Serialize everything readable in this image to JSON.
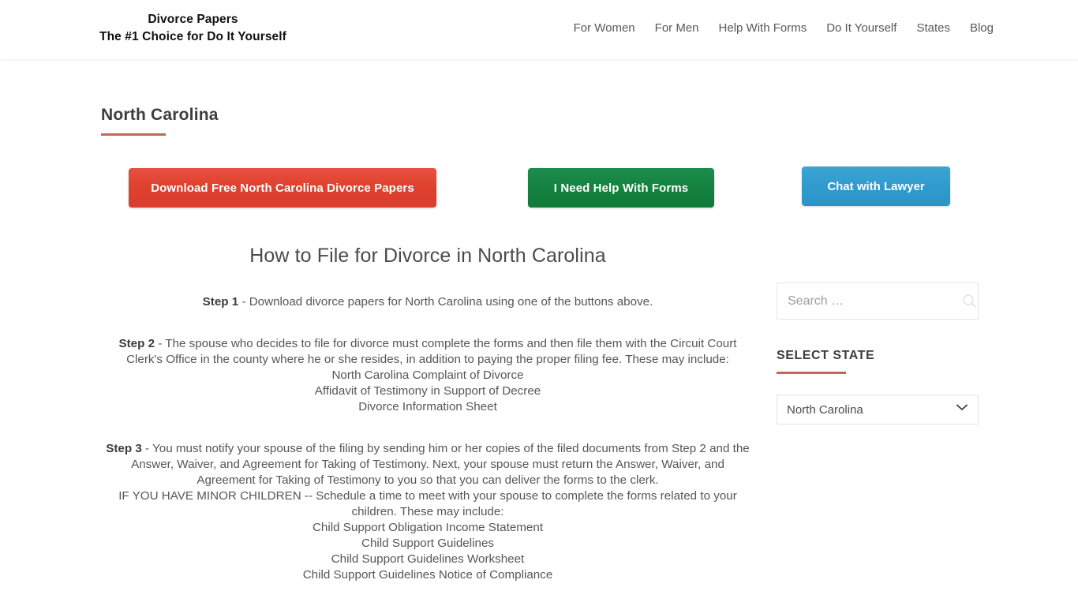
{
  "header": {
    "brand_line1": "Divorce Papers",
    "brand_line2": "The #1 Choice for Do It Yourself",
    "nav": [
      {
        "label": "For Women"
      },
      {
        "label": "For Men"
      },
      {
        "label": "Help With Forms"
      },
      {
        "label": "Do It Yourself"
      },
      {
        "label": "States"
      },
      {
        "label": "Blog"
      }
    ]
  },
  "main": {
    "page_title": "North Carolina",
    "buttons": {
      "download_label": "Download Free North Carolina Divorce Papers",
      "help_label": "I Need Help With Forms"
    },
    "article_title": "How to File for Divorce in North Carolina",
    "steps": [
      {
        "label": "Step 1",
        "text": " - Download divorce papers for North Carolina using one of the buttons above.",
        "documents": []
      },
      {
        "label": "Step 2",
        "text": " - The spouse who decides to file for divorce must complete the forms and then file them with the Circuit Court Clerk's Office in the county where he or she resides, in addition to paying the proper filing fee. These may include:",
        "documents": [
          "North Carolina Complaint of Divorce",
          "Affidavit of Testimony in Support of Decree",
          "Divorce Information Sheet"
        ]
      },
      {
        "label": "Step 3",
        "text": " - You must notify your spouse of the filing by sending him or her copies of the filed documents from Step 2 and the Answer, Waiver, and Agreement for Taking of Testimony. Next, your spouse must return the Answer, Waiver, and Agreement for Taking of Testimony to you so that you can deliver the forms to the clerk.",
        "note": "IF YOU HAVE MINOR CHILDREN -- Schedule a time to meet with your spouse to complete the forms related to your children. These may include:",
        "documents": [
          "Child Support Obligation Income Statement",
          "Child Support Guidelines",
          "Child Support Guidelines Worksheet",
          "Child Support Guidelines Notice of Compliance"
        ]
      }
    ]
  },
  "sidebar": {
    "chat_button_label": "Chat with Lawyer",
    "search": {
      "placeholder": "Search …",
      "value": "",
      "icon": "search-icon"
    },
    "select_state": {
      "title": "SELECT STATE",
      "selected": "North Carolina",
      "options": [
        "North Carolina"
      ]
    }
  },
  "colors": {
    "accent_rule": "#c0675b",
    "download_button": "#e0412f",
    "help_button": "#14823f",
    "chat_button": "#2f9bcd"
  }
}
